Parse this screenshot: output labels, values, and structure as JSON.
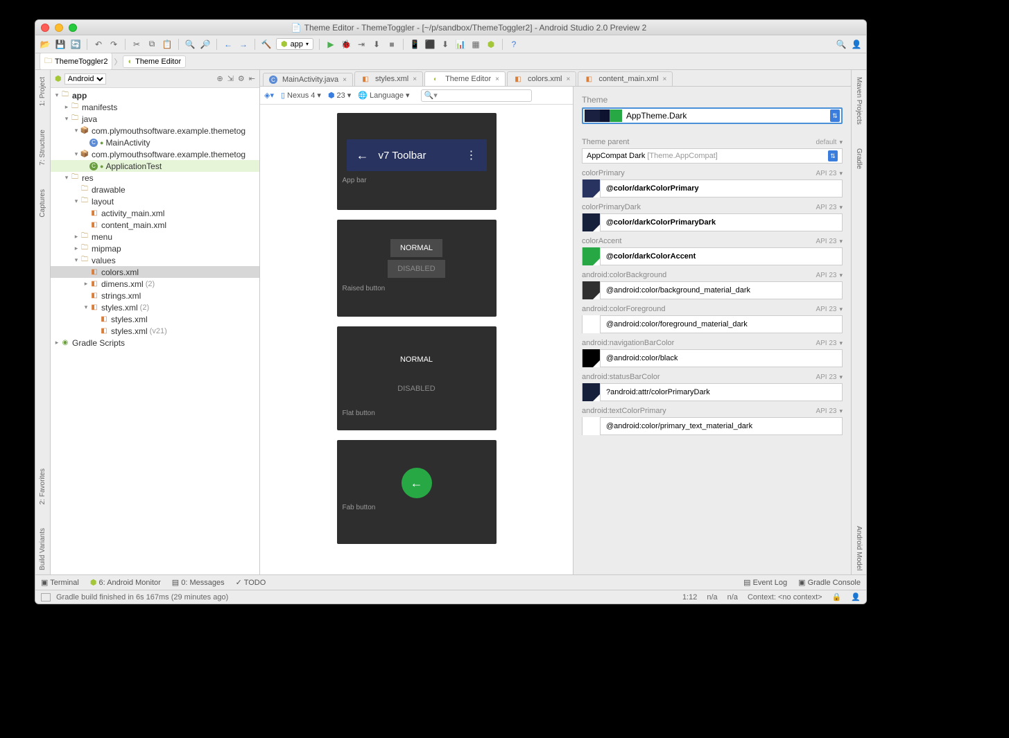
{
  "window_title": "Theme Editor - ThemeToggler - [~/p/sandbox/ThemeToggler2] - Android Studio 2.0 Preview 2",
  "breadcrumbs": [
    "ThemeToggler2",
    "Theme Editor"
  ],
  "app_selector": "app",
  "left_tabs": [
    "1: Project",
    "7: Structure",
    "Captures",
    "2: Favorites",
    "Build Variants"
  ],
  "right_tabs": [
    "Maven Projects",
    "Gradle",
    "Android Model"
  ],
  "project_view": "Android",
  "tree": {
    "app": "app",
    "manifests": "manifests",
    "java": "java",
    "pkg1": "com.plymouthsoftware.example.themetog",
    "main_activity": "MainActivity",
    "pkg2": "com.plymouthsoftware.example.themetog",
    "app_test": "ApplicationTest",
    "res": "res",
    "drawable": "drawable",
    "layout": "layout",
    "activity_main": "activity_main.xml",
    "content_main": "content_main.xml",
    "menu": "menu",
    "mipmap": "mipmap",
    "values": "values",
    "colors": "colors.xml",
    "dimens": "dimens.xml",
    "dimens_n": "(2)",
    "strings": "strings.xml",
    "styles": "styles.xml",
    "styles_n": "(2)",
    "styles1": "styles.xml",
    "styles2": "styles.xml",
    "styles2_n": "(v21)",
    "gradle": "Gradle Scripts"
  },
  "editor_tabs": [
    {
      "label": "MainActivity.java",
      "icon": "c"
    },
    {
      "label": "styles.xml",
      "icon": "xml"
    },
    {
      "label": "Theme Editor",
      "icon": "theme",
      "active": true
    },
    {
      "label": "colors.xml",
      "icon": "xml"
    },
    {
      "label": "content_main.xml",
      "icon": "xml"
    }
  ],
  "preview_toolbar": {
    "device": "Nexus 4",
    "api": "23",
    "lang": "Language"
  },
  "preview": {
    "toolbar_title": "v7 Toolbar",
    "appbar_label": "App bar",
    "normal": "NORMAL",
    "disabled": "DISABLED",
    "raised_label": "Raised button",
    "flat_label": "Flat button",
    "fab_label": "Fab button"
  },
  "theme": {
    "label": "Theme",
    "name": "AppTheme.Dark",
    "parent_label": "Theme parent",
    "parent_default": "default",
    "parent_name": "AppCompat Dark",
    "parent_sub": "[Theme.AppCompat]"
  },
  "attrs": [
    {
      "name": "colorPrimary",
      "api": "API 23",
      "val": "@color/darkColorPrimary",
      "sw": "#283360",
      "bold": true
    },
    {
      "name": "colorPrimaryDark",
      "api": "API 23",
      "val": "@color/darkColorPrimaryDark",
      "sw": "#16203a",
      "bold": true
    },
    {
      "name": "colorAccent",
      "api": "API 23",
      "val": "@color/darkColorAccent",
      "sw": "#28a745",
      "bold": true
    },
    {
      "name": "android:colorBackground",
      "api": "API 23",
      "val": "@android:color/background_material_dark",
      "sw": "#303030",
      "bold": false
    },
    {
      "name": "android:colorForeground",
      "api": "API 23",
      "val": "@android:color/foreground_material_dark",
      "sw": "#ffffff",
      "bold": false
    },
    {
      "name": "android:navigationBarColor",
      "api": "API 23",
      "val": "@android:color/black",
      "sw": "#000000",
      "bold": false
    },
    {
      "name": "android:statusBarColor",
      "api": "API 23",
      "val": "?android:attr/colorPrimaryDark",
      "sw": "#16203a",
      "bold": false
    },
    {
      "name": "android:textColorPrimary",
      "api": "API 23",
      "val": "@android:color/primary_text_material_dark",
      "sw": "#ffffff",
      "bold": false
    }
  ],
  "bottom_tools": {
    "terminal": "Terminal",
    "monitor": "6: Android Monitor",
    "messages": "0: Messages",
    "todo": "TODO",
    "eventlog": "Event Log",
    "gradlec": "Gradle Console"
  },
  "status": {
    "msg": "Gradle build finished in 6s 167ms (29 minutes ago)",
    "pos": "1:12",
    "na1": "n/a",
    "na2": "n/a",
    "ctx": "Context: <no context>"
  }
}
